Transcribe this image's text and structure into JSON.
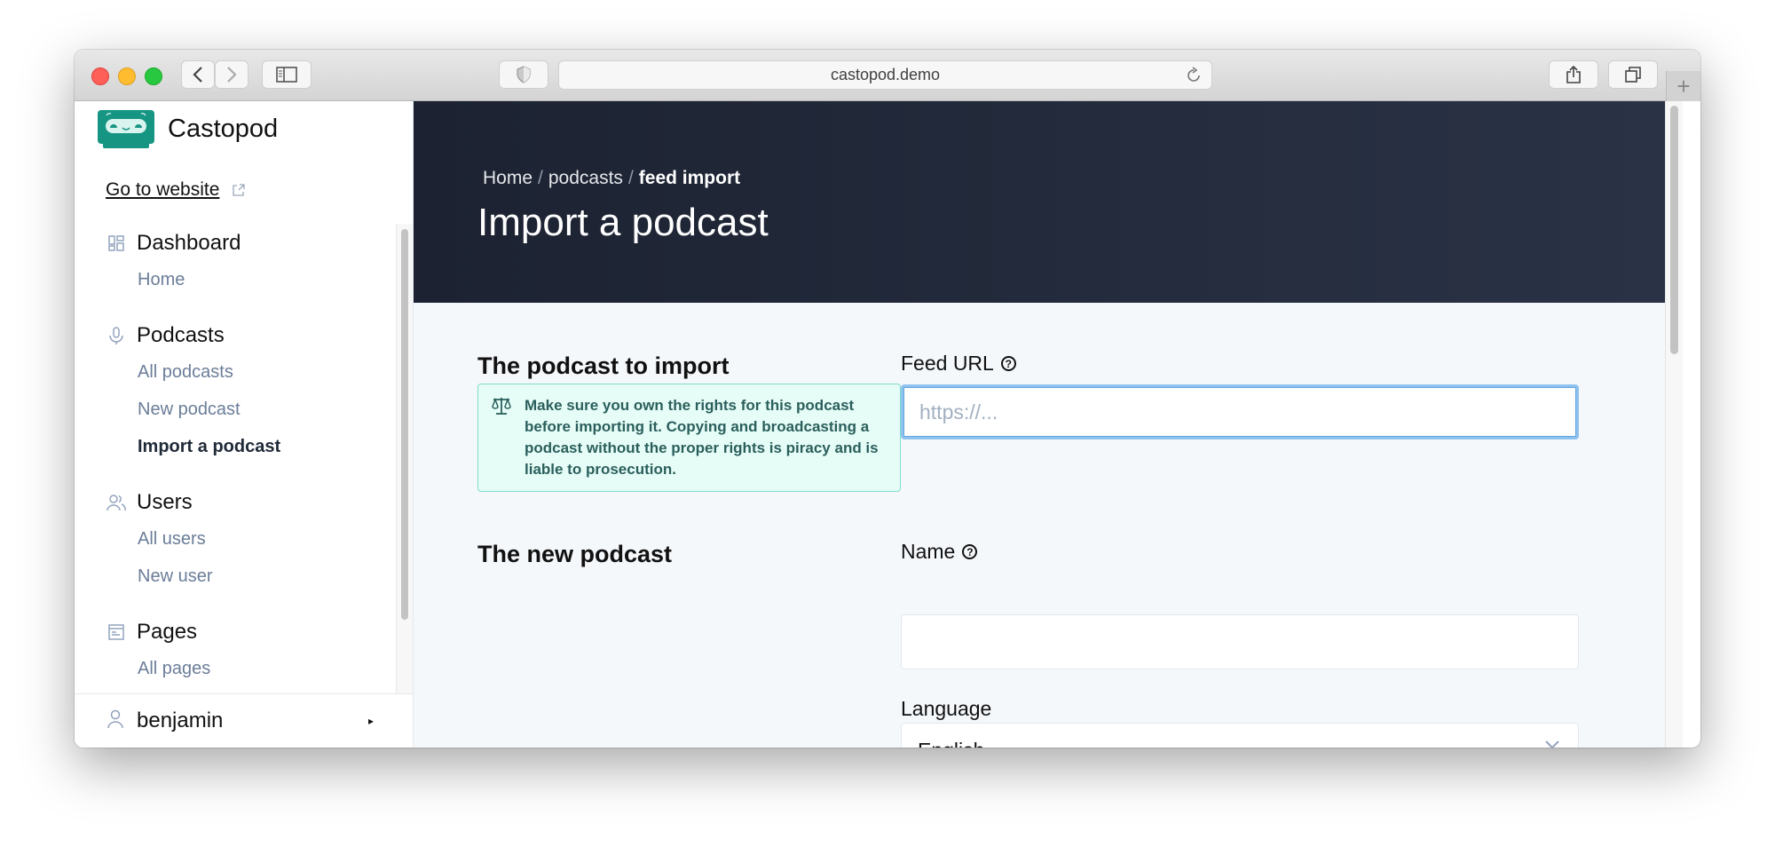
{
  "browser": {
    "url": "castopod.demo",
    "back_icon": "chevron-left-icon",
    "forward_icon": "chevron-right-icon",
    "sidebar_icon": "sidebar-icon",
    "shield_icon": "shield-icon",
    "reload_icon": "reload-icon",
    "share_icon": "share-icon",
    "tabs_icon": "tabs-icon",
    "new_tab_icon": "plus-icon"
  },
  "sidebar": {
    "brand": "Castopod",
    "go_to_website": "Go to website",
    "groups": [
      {
        "label": "Dashboard",
        "icon": "dashboard-icon",
        "items": [
          {
            "label": "Home",
            "active": false
          }
        ]
      },
      {
        "label": "Podcasts",
        "icon": "microphone-icon",
        "items": [
          {
            "label": "All podcasts",
            "active": false
          },
          {
            "label": "New podcast",
            "active": false
          },
          {
            "label": "Import a podcast",
            "active": true
          }
        ]
      },
      {
        "label": "Users",
        "icon": "users-icon",
        "items": [
          {
            "label": "All users",
            "active": false
          },
          {
            "label": "New user",
            "active": false
          }
        ]
      },
      {
        "label": "Pages",
        "icon": "pages-icon",
        "items": [
          {
            "label": "All pages",
            "active": false
          }
        ]
      }
    ],
    "user": {
      "name": "benjamin",
      "icon": "user-icon"
    }
  },
  "header": {
    "breadcrumb": [
      "Home",
      "podcasts",
      "feed import"
    ],
    "separator": "/",
    "title": "Import a podcast"
  },
  "form": {
    "section_import": "The podcast to import",
    "notice": "Make sure you own the rights for this podcast before importing it. Copying and broadcasting a podcast without the proper rights is piracy and is liable to prosecution.",
    "feed_url": {
      "label": "Feed URL",
      "placeholder": "https://...",
      "value": ""
    },
    "section_new": "The new podcast",
    "name": {
      "label": "Name",
      "value": ""
    },
    "language": {
      "label": "Language",
      "value": "English"
    },
    "help_glyph": "?"
  },
  "colors": {
    "hero_bg": "#1f2638",
    "notice_bg": "#e6fdf7",
    "notice_border": "#7fdccb",
    "notice_text": "#2b5f5c",
    "brand": "#179583",
    "focus_ring": "#8fc3ef"
  }
}
